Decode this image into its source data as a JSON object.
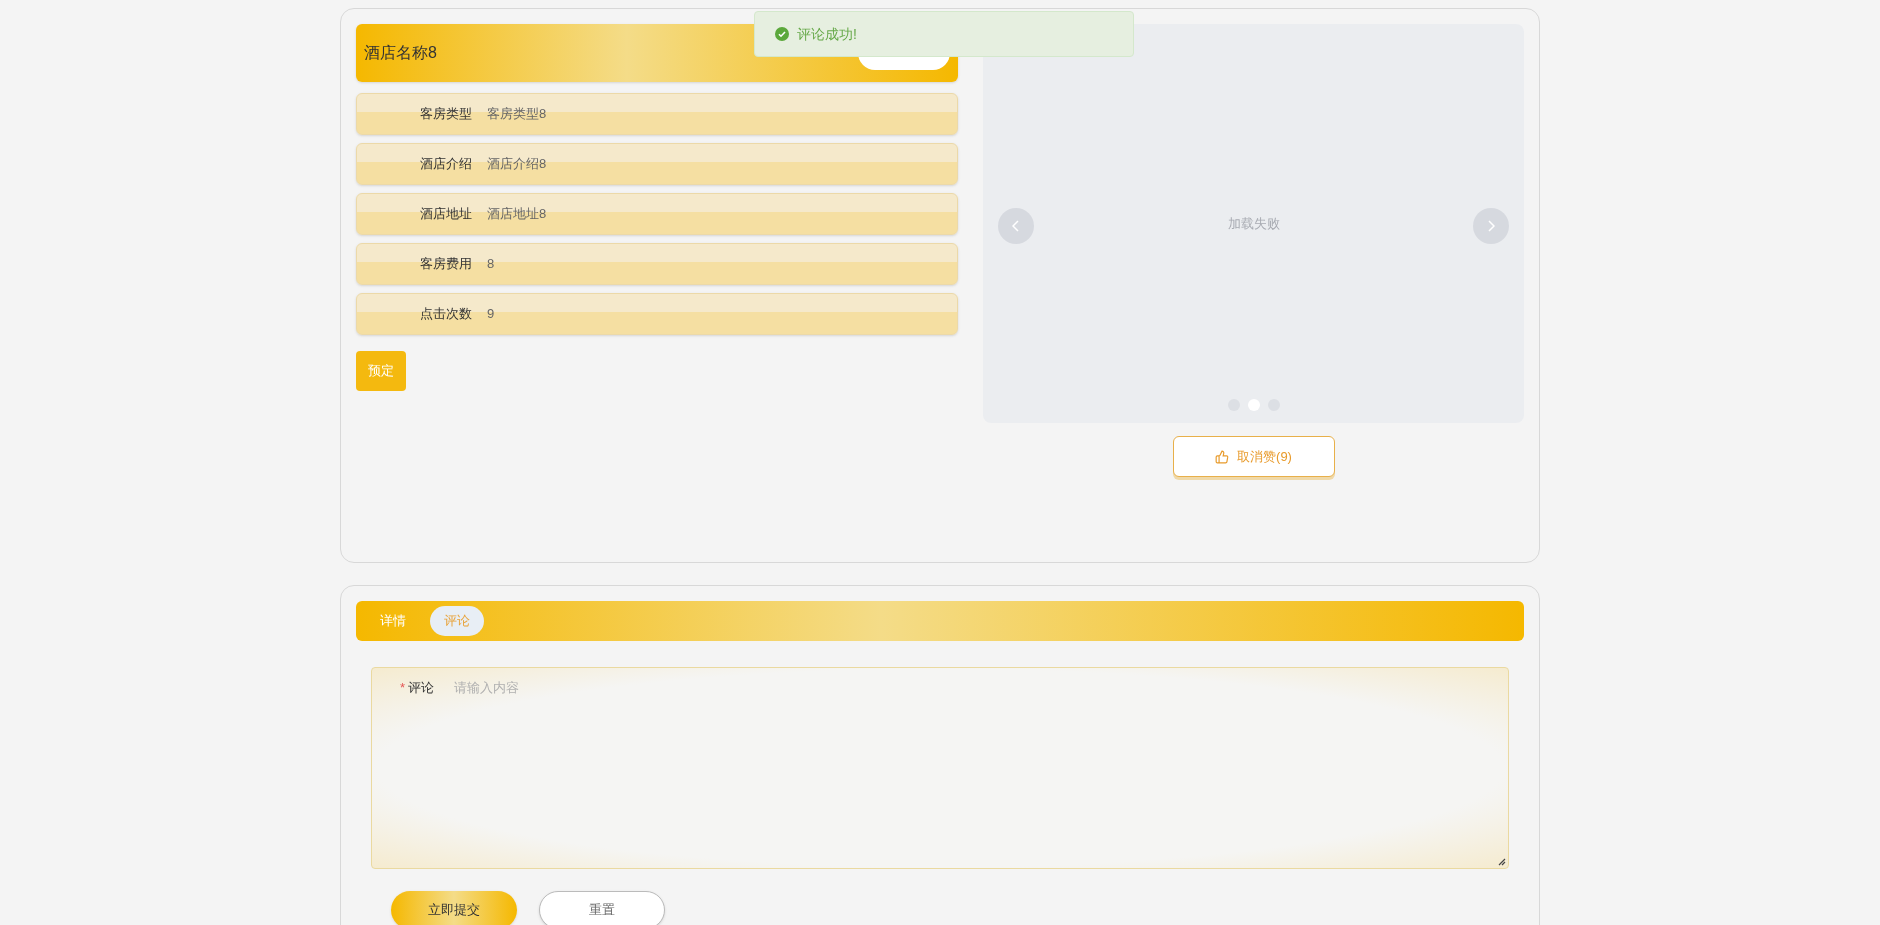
{
  "toast": {
    "kind": "success",
    "message": "评论成功!"
  },
  "hotel": {
    "name": "酒店名称8",
    "fields": [
      {
        "label": "客房类型",
        "value": "客房类型8"
      },
      {
        "label": "酒店介绍",
        "value": "酒店介绍8"
      },
      {
        "label": "酒店地址",
        "value": "酒店地址8"
      },
      {
        "label": "客房费用",
        "value": "8"
      },
      {
        "label": "点击次数",
        "value": "9"
      }
    ],
    "book_button": "预定"
  },
  "carousel": {
    "error_text": "加载失败",
    "indicators": [
      {
        "selected": false
      },
      {
        "selected": true
      },
      {
        "selected": false
      }
    ]
  },
  "like_button": "取消赞(9)",
  "tabs": [
    {
      "label": "详情",
      "selected": false
    },
    {
      "label": "评论",
      "selected": true
    }
  ],
  "comment_form": {
    "required_mark": "*",
    "label": "评论",
    "placeholder": "请输入内容",
    "buttons": [
      {
        "kind": "primary",
        "label": "立即提交"
      },
      {
        "kind": "plain",
        "label": "重置"
      }
    ]
  }
}
